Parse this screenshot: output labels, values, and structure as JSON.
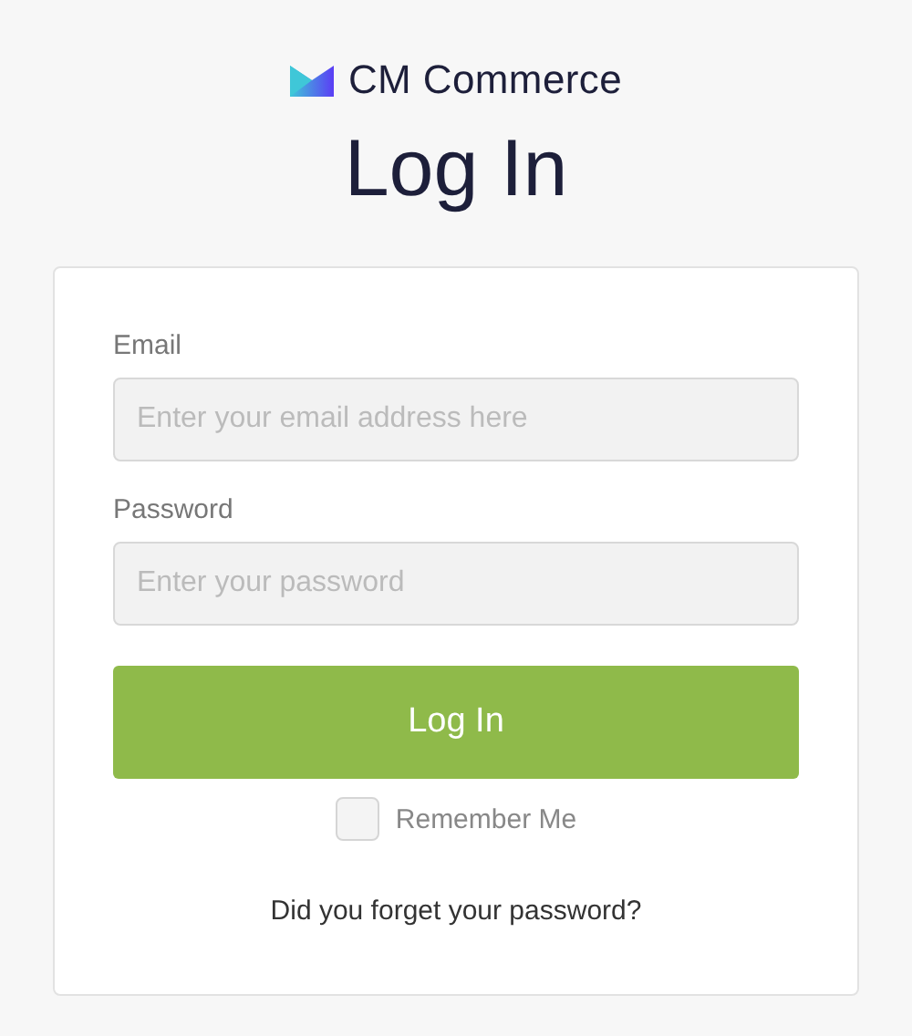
{
  "brand": {
    "name": "CM Commerce"
  },
  "title": "Log In",
  "form": {
    "fields": [
      {
        "label": "Email",
        "placeholder": "Enter your email address here"
      },
      {
        "label": "Password",
        "placeholder": "Enter your password"
      }
    ],
    "submit": "Log In",
    "remember": {
      "label": "Remember Me",
      "checked": false
    },
    "forgot_link": "Did you forget your password?"
  }
}
